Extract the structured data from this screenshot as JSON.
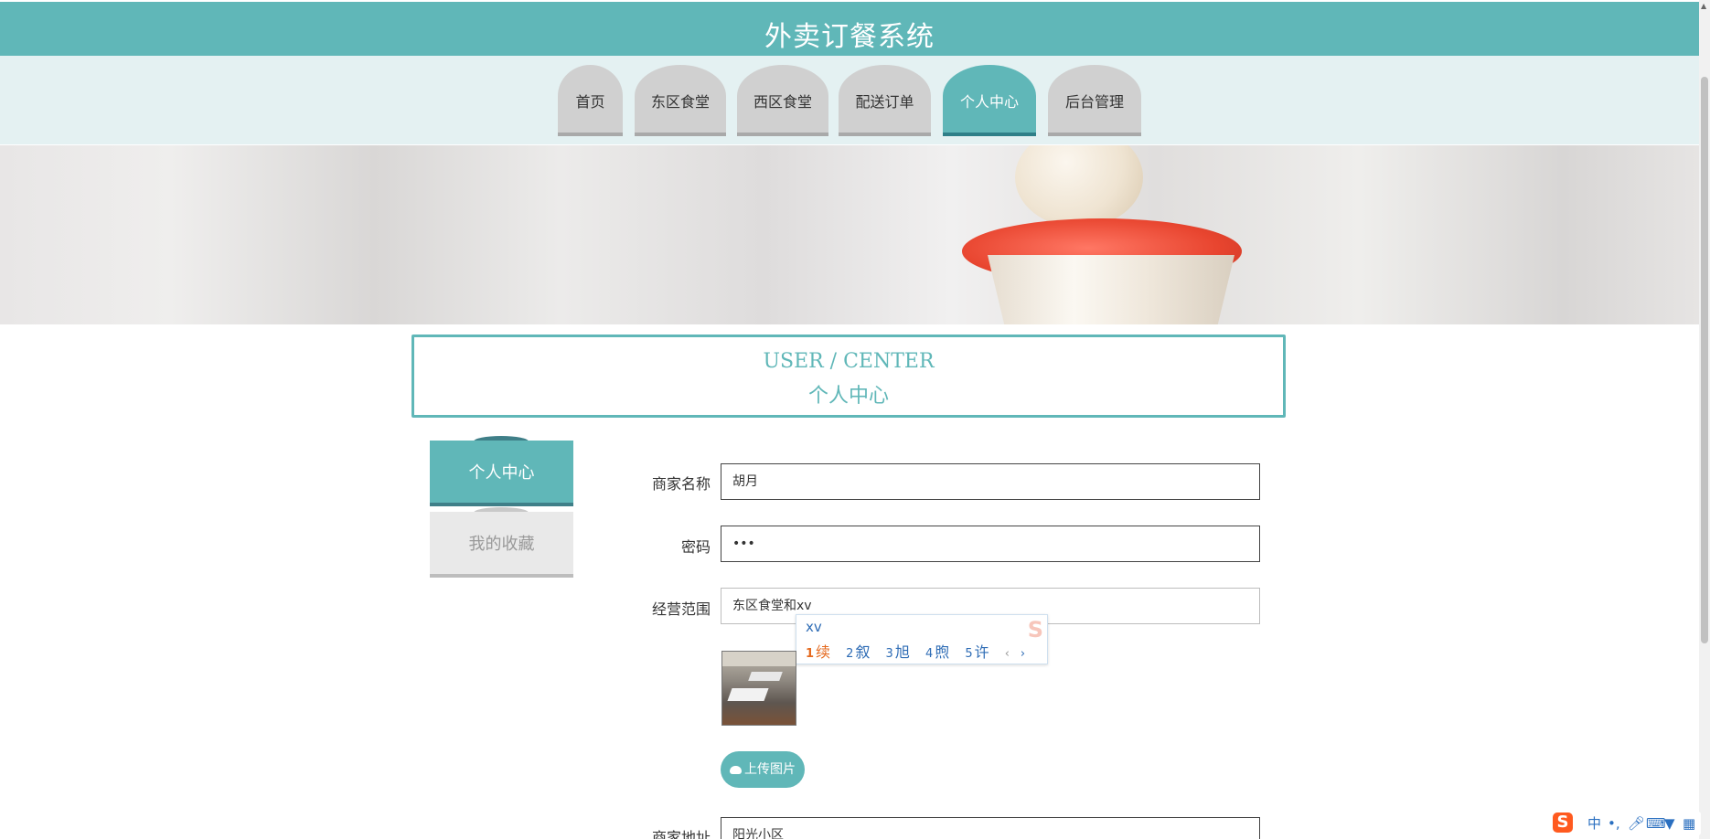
{
  "header": {
    "title": "外卖订餐系统"
  },
  "nav": {
    "tabs": [
      {
        "label": "首页",
        "active": false
      },
      {
        "label": "东区食堂",
        "active": false
      },
      {
        "label": "西区食堂",
        "active": false
      },
      {
        "label": "配送订单",
        "active": false
      },
      {
        "label": "个人中心",
        "active": true
      },
      {
        "label": "后台管理",
        "active": false
      }
    ]
  },
  "section": {
    "title_en": "USER / CENTER",
    "title_cn": "个人中心"
  },
  "sidebar": {
    "items": [
      {
        "label": "个人中心",
        "active": true
      },
      {
        "label": "我的收藏",
        "active": false
      }
    ]
  },
  "form": {
    "merchant_name": {
      "label": "商家名称",
      "value": "胡月"
    },
    "password": {
      "label": "密码",
      "value": "•••"
    },
    "business_scope": {
      "label": "经营范围",
      "value": "东区食堂和xv"
    },
    "upload_label": "上传图片",
    "address": {
      "label": "商家地址",
      "value": "阳光小区"
    }
  },
  "ime_popup": {
    "composition": "xv",
    "candidates": [
      {
        "num": "1",
        "char": "续"
      },
      {
        "num": "2",
        "char": "叙"
      },
      {
        "num": "3",
        "char": "旭"
      },
      {
        "num": "4",
        "char": "煦"
      },
      {
        "num": "5",
        "char": "许"
      }
    ],
    "nav_prev": "‹",
    "nav_next": "›"
  },
  "ime_statusbar": {
    "mode": "中"
  },
  "colors": {
    "accent": "#60b7b8",
    "accent_dark": "#3f7f88",
    "nav_bg": "#e4f1f2"
  }
}
